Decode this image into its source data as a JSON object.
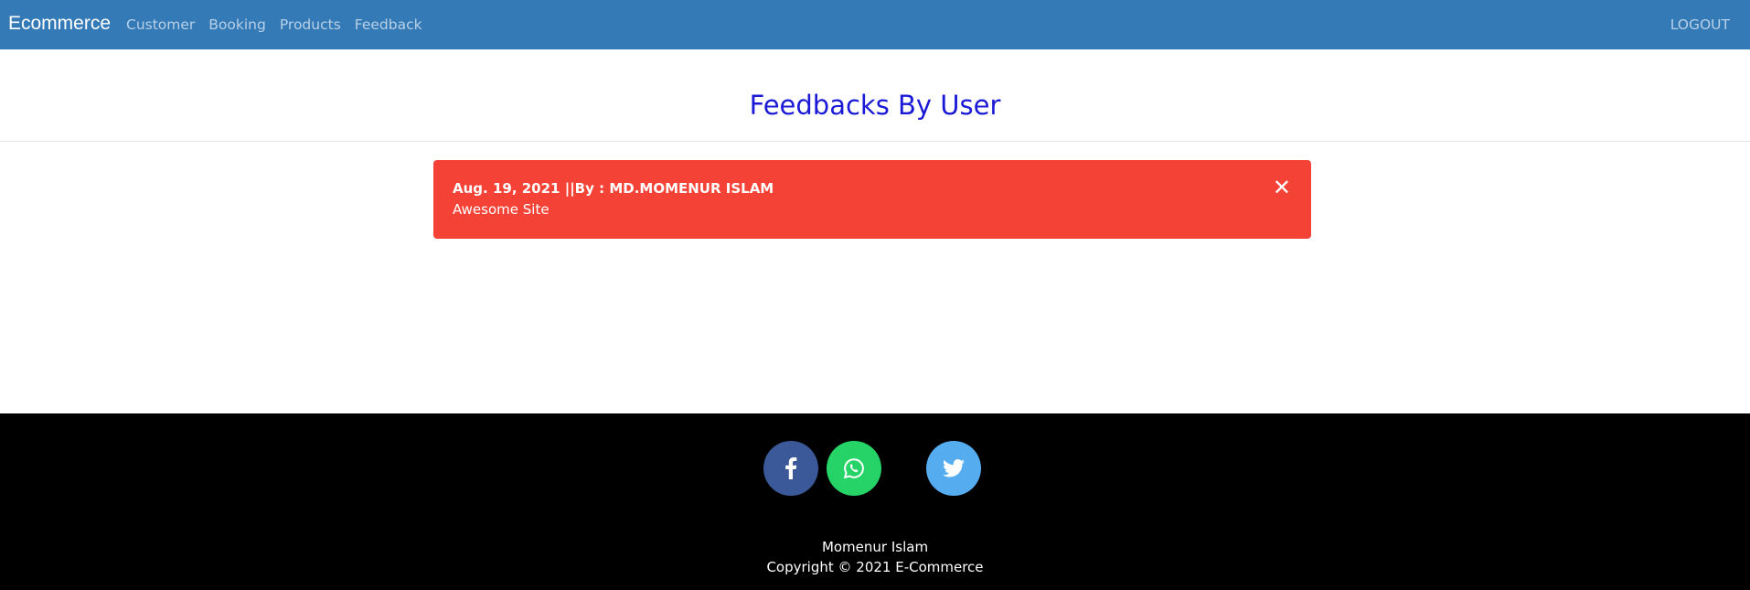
{
  "navbar": {
    "brand": "Ecommerce",
    "links": [
      {
        "label": "Customer"
      },
      {
        "label": "Booking"
      },
      {
        "label": "Products"
      },
      {
        "label": "Feedback"
      }
    ],
    "logout_label": "LOGOUT",
    "background": "#337ab7"
  },
  "main": {
    "title": "Feedbacks By User",
    "feedbacks": [
      {
        "meta": "Aug. 19, 2021 ||By : MD.MOMENUR ISLAM",
        "message": "Awesome Site",
        "close_symbol": "✕",
        "color": "#f44336"
      }
    ]
  },
  "footer": {
    "social": [
      {
        "name": "facebook-icon",
        "color": "#3b5998"
      },
      {
        "name": "whatsapp-icon",
        "color": "#25d366"
      },
      {
        "name": "twitter-icon",
        "color": "#55acee"
      }
    ],
    "author": "Momenur Islam",
    "copyright": "Copyright © 2021 E-Commerce"
  }
}
